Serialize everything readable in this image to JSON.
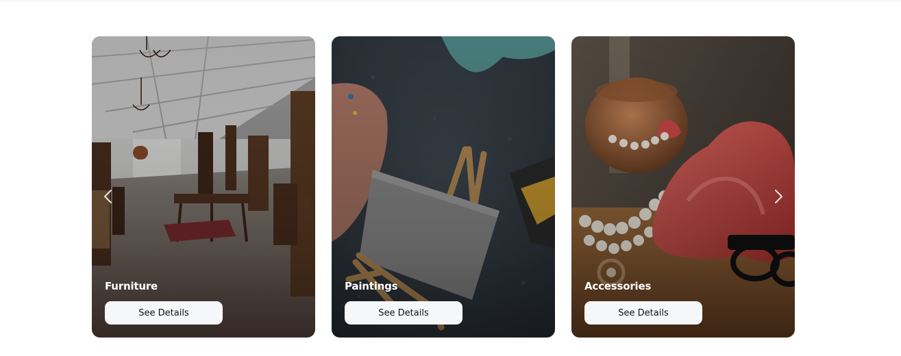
{
  "carousel": {
    "cards": [
      {
        "title": "Furniture",
        "button_label": "See Details",
        "image": "antique-furniture-showroom"
      },
      {
        "title": "Paintings",
        "button_label": "See Details",
        "image": "easel-canvas-palette"
      },
      {
        "title": "Accessories",
        "button_label": "See Details",
        "image": "pearls-scarf-sunglasses"
      }
    ],
    "prev_icon": "chevron-left-icon",
    "next_icon": "chevron-right-icon"
  },
  "colors": {
    "button_bg": "#f6f7f9",
    "title_text": "#ffffff"
  }
}
